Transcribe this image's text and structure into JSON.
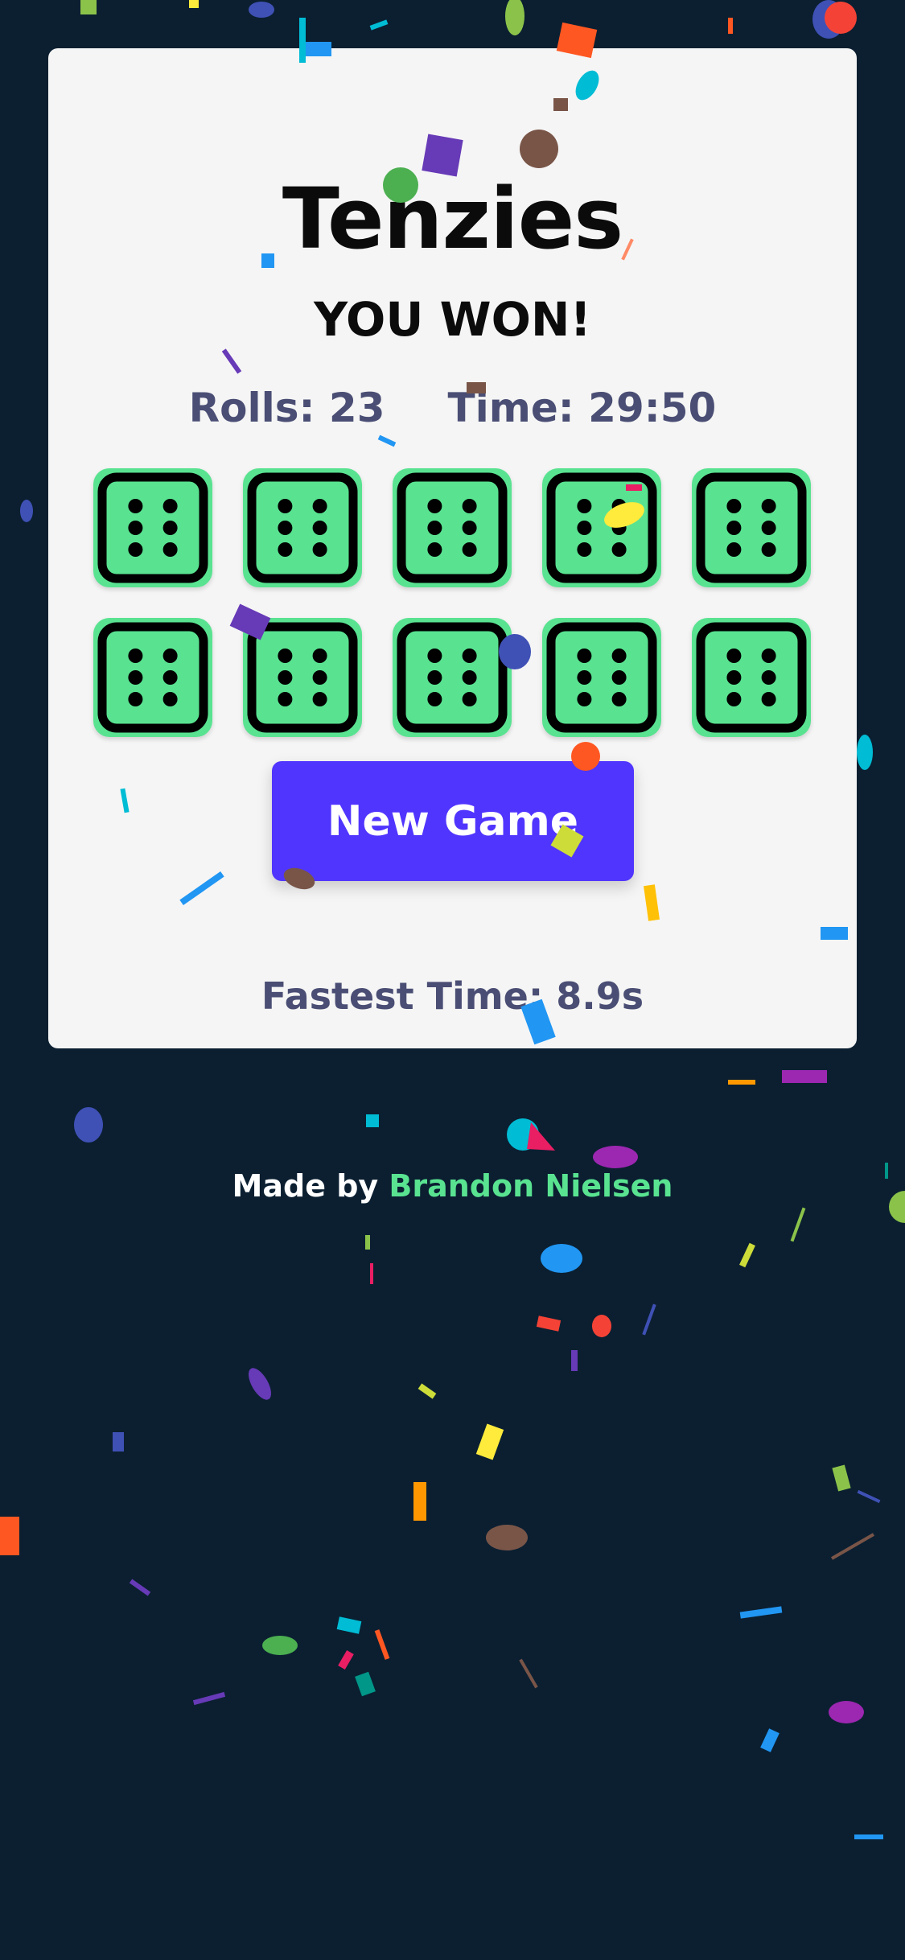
{
  "app": {
    "title": "Tenzies",
    "status": "YOU WON!"
  },
  "stats": {
    "rolls": "Rolls: 23",
    "time": "Time: 29:50"
  },
  "dice": [
    {
      "value": 6,
      "held": true
    },
    {
      "value": 6,
      "held": true
    },
    {
      "value": 6,
      "held": true
    },
    {
      "value": 6,
      "held": true
    },
    {
      "value": 6,
      "held": true
    },
    {
      "value": 6,
      "held": true
    },
    {
      "value": 6,
      "held": true
    },
    {
      "value": 6,
      "held": true
    },
    {
      "value": 6,
      "held": true
    },
    {
      "value": 6,
      "held": true
    }
  ],
  "actions": {
    "new_game_label": "New Game"
  },
  "fastest": "Fastest Time: 8.9s",
  "footer": {
    "prefix": "Made by",
    "author": "Brandon Nielsen"
  },
  "colors": {
    "background": "#0b1f31",
    "card": "#f5f5f5",
    "held_die": "#59e391",
    "button": "#5035ff",
    "muted_text": "#4a4e74"
  }
}
